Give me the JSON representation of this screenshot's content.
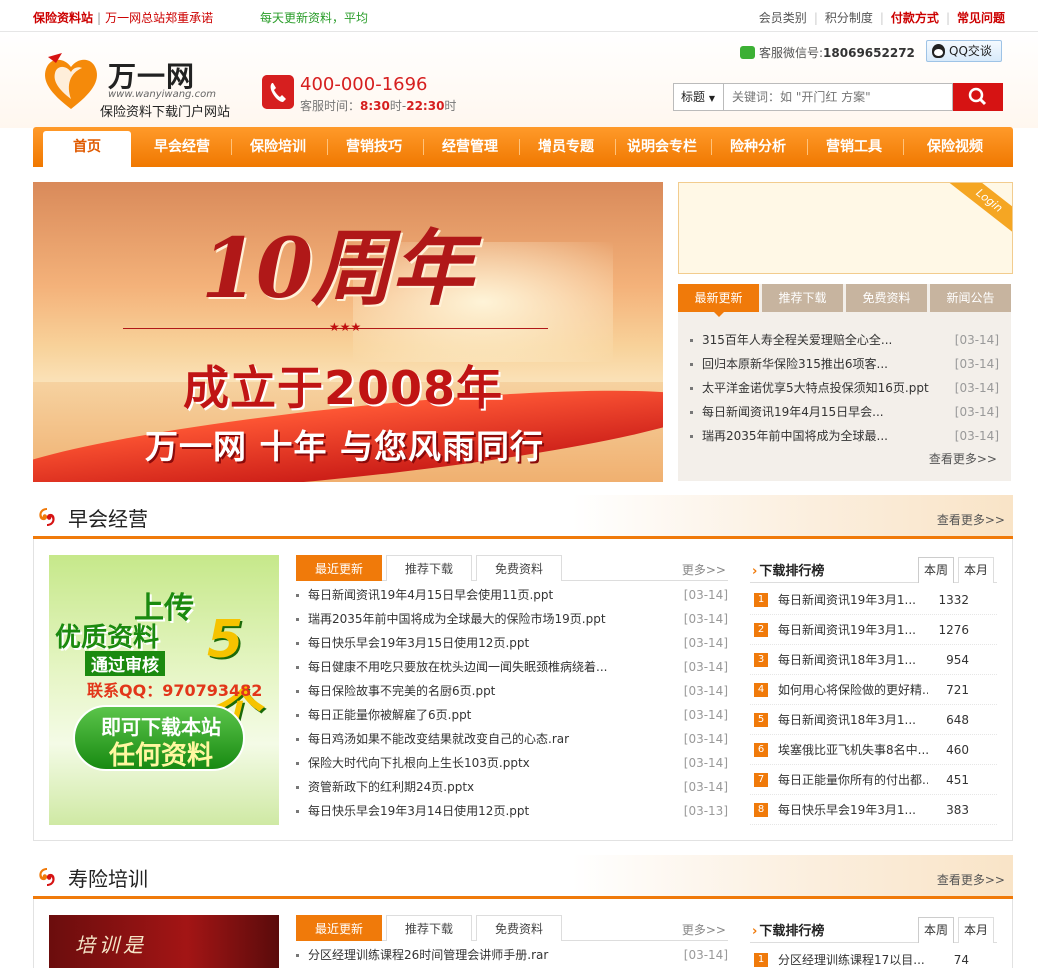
{
  "topbar": {
    "site_name": "保险资料站",
    "promise": "万一网总站郑重承诺",
    "marquee": "每天更新资料，平均",
    "links": [
      "会员类别",
      "积分制度",
      "付款方式",
      "常见问题"
    ]
  },
  "header": {
    "logo_brand": "万一网",
    "logo_url": "www.wanyiwang.com",
    "logo_slogan": "保险资料下载门户网站",
    "phone": "400-000-1696",
    "hours_label": "客服时间：",
    "hours_start": "8:30",
    "hours_mid": "时-",
    "hours_end": "22:30",
    "hours_tail": "时",
    "wechat_label": "客服微信号:",
    "wechat_id": "18069652272",
    "qq_label": "QQ交谈",
    "search_select": "标题",
    "search_placeholder": "关键词：如 \"开门红 方案\""
  },
  "nav": {
    "items": [
      "首页",
      "早会经营",
      "保险培训",
      "营销技巧",
      "经营管理",
      "增员专题",
      "说明会专栏",
      "险种分析",
      "营销工具",
      "保险视频"
    ]
  },
  "banner": {
    "anniversary": "10周年",
    "stars": "★★★",
    "established": "成立于2008年",
    "motto": "万一网 十年 与您风雨同行"
  },
  "login": {
    "corner_label": "Login"
  },
  "news": {
    "tabs": [
      "最新更新",
      "推荐下载",
      "免费资料",
      "新闻公告"
    ],
    "items": [
      {
        "title": "315百年人寿全程关爱理赔全心全...",
        "date": "[03-14]"
      },
      {
        "title": "回归本原新华保险315推出6项客...",
        "date": "[03-14]"
      },
      {
        "title": "太平洋金诺优享5大特点投保须知16页.ppt",
        "date": "[03-14]"
      },
      {
        "title": "每日新闻资讯19年4月15日早会...",
        "date": "[03-14]"
      },
      {
        "title": "瑞再2035年前中国将成为全球最...",
        "date": "[03-14]"
      }
    ],
    "more": "查看更多>>"
  },
  "section1": {
    "title": "早会经营",
    "more": "查看更多>>",
    "promo": {
      "line1": "上传",
      "line2": "优质资料",
      "line3": "通过审核",
      "count": "5个",
      "qq": "联系QQ：970793482",
      "pill1": "即可下载本站",
      "pill2": "任何资料"
    },
    "tabs": [
      "最近更新",
      "推荐下载",
      "免费资料"
    ],
    "tabs_more": "更多>>",
    "items": [
      {
        "title": "每日新闻资讯19年4月15日早会使用11页.ppt",
        "date": "[03-14]"
      },
      {
        "title": "瑞再2035年前中国将成为全球最大的保险市场19页.ppt",
        "date": "[03-14]"
      },
      {
        "title": "每日快乐早会19年3月15日使用12页.ppt",
        "date": "[03-14]"
      },
      {
        "title": "每日健康不用吃只要放在枕头边闻一闻失眠颈椎病绕着...",
        "date": "[03-14]"
      },
      {
        "title": "每日保险故事不完美的名厨6页.ppt",
        "date": "[03-14]"
      },
      {
        "title": "每日正能量你被解雇了6页.ppt",
        "date": "[03-14]"
      },
      {
        "title": "每日鸡汤如果不能改变结果就改变自己的心态.rar",
        "date": "[03-14]"
      },
      {
        "title": "保险大时代向下扎根向上生长103页.pptx",
        "date": "[03-14]"
      },
      {
        "title": "资管新政下的红利期24页.pptx",
        "date": "[03-14]"
      },
      {
        "title": "每日快乐早会19年3月14日使用12页.ppt",
        "date": "[03-13]"
      }
    ],
    "rank_title": "下载排行榜",
    "rank_tabs": [
      "本周",
      "本月"
    ],
    "rank": [
      {
        "n": "1",
        "title": "每日新闻资讯19年3月1...",
        "count": "1332"
      },
      {
        "n": "2",
        "title": "每日新闻资讯19年3月1...",
        "count": "1276"
      },
      {
        "n": "3",
        "title": "每日新闻资讯18年3月1...",
        "count": "954"
      },
      {
        "n": "4",
        "title": "如何用心将保险做的更好精...",
        "count": "721"
      },
      {
        "n": "5",
        "title": "每日新闻资讯18年3月1...",
        "count": "648"
      },
      {
        "n": "6",
        "title": "埃塞俄比亚飞机失事8名中...",
        "count": "460"
      },
      {
        "n": "7",
        "title": "每日正能量你所有的付出都...",
        "count": "451"
      },
      {
        "n": "8",
        "title": "每日快乐早会19年3月1...",
        "count": "383"
      }
    ]
  },
  "section2": {
    "title": "寿险培训",
    "more": "查看更多>>",
    "promo_text": "培训是",
    "tabs": [
      "最近更新",
      "推荐下载",
      "免费资料"
    ],
    "tabs_more": "更多>>",
    "items": [
      {
        "title": "分区经理训练课程26时间管理会讲师手册.rar",
        "date": "[03-14]"
      }
    ],
    "rank_title": "下载排行榜",
    "rank_tabs": [
      "本周",
      "本月"
    ],
    "rank": [
      {
        "n": "1",
        "title": "分区经理训练课程17以目...",
        "count": "74"
      }
    ]
  },
  "colors": {
    "accent": "#f07a0a",
    "brand_red": "#d61313"
  }
}
